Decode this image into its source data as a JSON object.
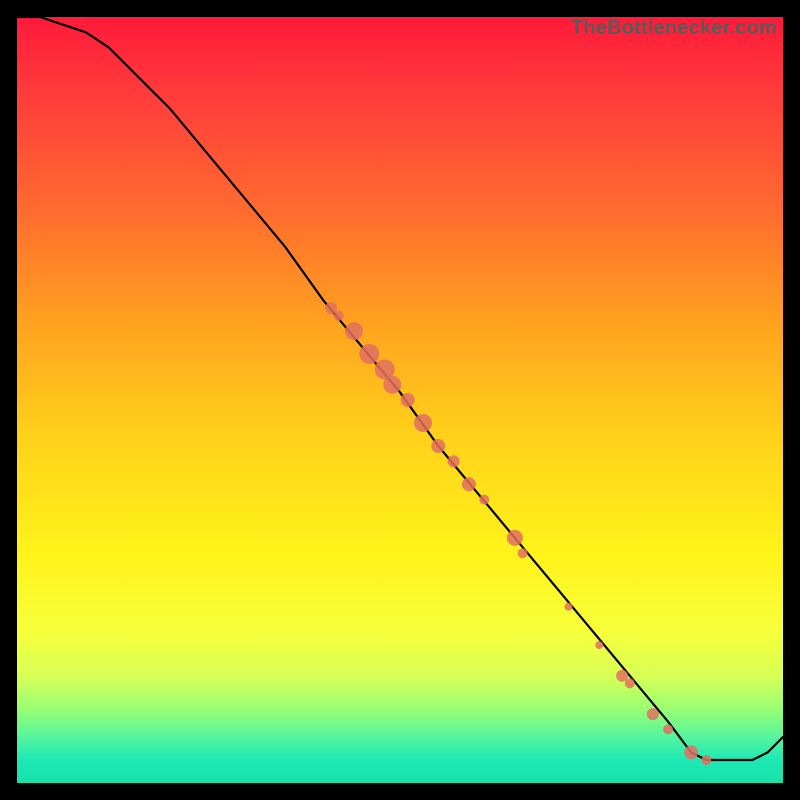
{
  "watermark": "TheBottlenecker.com",
  "colors": {
    "frame": "#000000",
    "curve_stroke": "#000000",
    "dot_fill": "#e2705f"
  },
  "chart_data": {
    "type": "line",
    "title": "",
    "xlabel": "",
    "ylabel": "",
    "xlim": [
      0,
      100
    ],
    "ylim": [
      0,
      100
    ],
    "series": [
      {
        "name": "bottleneck-curve",
        "x": [
          0,
          3,
          6,
          9,
          12,
          15,
          20,
          25,
          30,
          35,
          40,
          45,
          50,
          55,
          60,
          65,
          70,
          75,
          80,
          85,
          88,
          90,
          92,
          94,
          96,
          98,
          100
        ],
        "y": [
          100,
          100,
          99,
          98,
          96,
          93,
          88,
          82,
          76,
          70,
          63,
          57,
          51,
          44,
          38,
          32,
          26,
          20,
          14,
          8,
          4,
          3,
          3,
          3,
          3,
          4,
          6
        ]
      }
    ],
    "points": [
      {
        "x": 41,
        "y": 62,
        "r": 6
      },
      {
        "x": 42,
        "y": 61,
        "r": 5
      },
      {
        "x": 44,
        "y": 59,
        "r": 9
      },
      {
        "x": 46,
        "y": 56,
        "r": 10
      },
      {
        "x": 48,
        "y": 54,
        "r": 10
      },
      {
        "x": 49,
        "y": 52,
        "r": 9
      },
      {
        "x": 51,
        "y": 50,
        "r": 7
      },
      {
        "x": 53,
        "y": 47,
        "r": 9
      },
      {
        "x": 55,
        "y": 44,
        "r": 7
      },
      {
        "x": 57,
        "y": 42,
        "r": 6
      },
      {
        "x": 59,
        "y": 39,
        "r": 7
      },
      {
        "x": 61,
        "y": 37,
        "r": 5
      },
      {
        "x": 65,
        "y": 32,
        "r": 8
      },
      {
        "x": 66,
        "y": 30,
        "r": 5
      },
      {
        "x": 72,
        "y": 23,
        "r": 4
      },
      {
        "x": 76,
        "y": 18,
        "r": 4
      },
      {
        "x": 79,
        "y": 14,
        "r": 6
      },
      {
        "x": 80,
        "y": 13,
        "r": 5
      },
      {
        "x": 83,
        "y": 9,
        "r": 6
      },
      {
        "x": 85,
        "y": 7,
        "r": 5
      },
      {
        "x": 88,
        "y": 4,
        "r": 7
      },
      {
        "x": 90,
        "y": 3,
        "r": 5
      }
    ]
  }
}
